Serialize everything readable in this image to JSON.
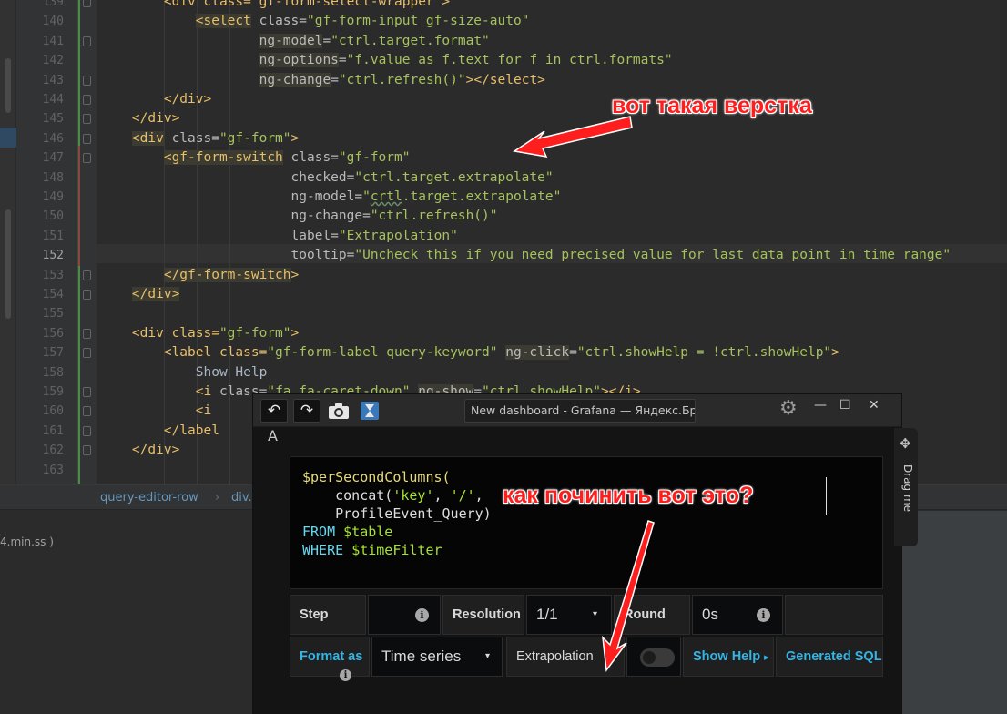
{
  "ide": {
    "line_numbers": [
      "139",
      "140",
      "141",
      "142",
      "143",
      "144",
      "145",
      "146",
      "147",
      "148",
      "149",
      "150",
      "151",
      "152",
      "153",
      "154",
      "155",
      "156",
      "157",
      "158",
      "159",
      "160",
      "161",
      "162",
      "163"
    ],
    "current_line": "152",
    "code_lines": [
      [
        {
          "t": "        <div class=\"gf-form-select-wrapper\">",
          "c": "tg"
        }
      ],
      [
        {
          "t": "            ",
          "c": "tx"
        },
        {
          "t": "<select",
          "c": "hlt"
        },
        {
          "t": " class=",
          "c": "an"
        },
        {
          "t": "\"gf-form-input gf-size-auto\"",
          "c": "av"
        }
      ],
      [
        {
          "t": "                    ",
          "c": "tx"
        },
        {
          "t": "ng-model",
          "c": "an hl"
        },
        {
          "t": "=",
          "c": "an"
        },
        {
          "t": "\"ctrl.target.format\"",
          "c": "av"
        }
      ],
      [
        {
          "t": "                    ",
          "c": "tx"
        },
        {
          "t": "ng-options",
          "c": "an hl"
        },
        {
          "t": "=",
          "c": "an"
        },
        {
          "t": "\"f.value as f.text for f in ctrl.formats\"",
          "c": "av"
        }
      ],
      [
        {
          "t": "                    ",
          "c": "tx"
        },
        {
          "t": "ng-change",
          "c": "an hl"
        },
        {
          "t": "=",
          "c": "an"
        },
        {
          "t": "\"ctrl.refresh()\"",
          "c": "av"
        },
        {
          "t": "></select>",
          "c": "tg"
        }
      ],
      [
        {
          "t": "        </div>",
          "c": "tg"
        }
      ],
      [
        {
          "t": "    </div>",
          "c": "tg"
        }
      ],
      [
        {
          "t": "    ",
          "c": "tx"
        },
        {
          "t": "<div",
          "c": "hlt"
        },
        {
          "t": " class=",
          "c": "an"
        },
        {
          "t": "\"gf-form\"",
          "c": "av"
        },
        {
          "t": ">",
          "c": "tg"
        }
      ],
      [
        {
          "t": "        ",
          "c": "tx"
        },
        {
          "t": "<gf-form-switch",
          "c": "hlt"
        },
        {
          "t": " class=",
          "c": "an"
        },
        {
          "t": "\"gf-form\"",
          "c": "av"
        }
      ],
      [
        {
          "t": "                        checked=",
          "c": "an"
        },
        {
          "t": "\"ctrl.target.extrapolate\"",
          "c": "av"
        }
      ],
      [
        {
          "t": "                        ng-model=",
          "c": "an"
        },
        {
          "t": "\"",
          "c": "av"
        },
        {
          "t": "crtl",
          "c": "av err"
        },
        {
          "t": ".target.extrapolate\"",
          "c": "av"
        }
      ],
      [
        {
          "t": "                        ng-change=",
          "c": "an"
        },
        {
          "t": "\"ctrl.refresh()\"",
          "c": "av"
        }
      ],
      [
        {
          "t": "                        label=",
          "c": "an"
        },
        {
          "t": "\"Extrapolation\"",
          "c": "av"
        }
      ],
      [
        {
          "t": "                        tooltip=",
          "c": "an"
        },
        {
          "t": "\"Uncheck this if you need precised value for last data point in time range\"",
          "c": "av"
        }
      ],
      [
        {
          "t": "        ",
          "c": "tx"
        },
        {
          "t": "</gf-form-switch",
          "c": "hlt"
        },
        {
          "t": ">",
          "c": "tg"
        }
      ],
      [
        {
          "t": "    ",
          "c": "tx"
        },
        {
          "t": "</div>",
          "c": "hlt"
        }
      ],
      [
        {
          "t": "",
          "c": "tx"
        }
      ],
      [
        {
          "t": "    <div class=",
          "c": "tg"
        },
        {
          "t": "\"gf-form\"",
          "c": "av"
        },
        {
          "t": ">",
          "c": "tg"
        }
      ],
      [
        {
          "t": "        <label class=",
          "c": "tg"
        },
        {
          "t": "\"gf-form-label query-keyword\"",
          "c": "av"
        },
        {
          "t": " ",
          "c": "tx"
        },
        {
          "t": "ng-click",
          "c": "an hl"
        },
        {
          "t": "=",
          "c": "an"
        },
        {
          "t": "\"ctrl.showHelp = !ctrl.showHelp\"",
          "c": "av"
        },
        {
          "t": ">",
          "c": "tg"
        }
      ],
      [
        {
          "t": "            Show Help",
          "c": "tx"
        }
      ],
      [
        {
          "t": "            <i ",
          "c": "tg"
        },
        {
          "t": "class=",
          "c": "an"
        },
        {
          "t": "\"fa fa-caret-down\"",
          "c": "av"
        },
        {
          "t": " ",
          "c": "tx"
        },
        {
          "t": "ng-show",
          "c": "an hl"
        },
        {
          "t": "=",
          "c": "an"
        },
        {
          "t": "\"ctrl.showHelp\"",
          "c": "av"
        },
        {
          "t": "></i>",
          "c": "tg"
        }
      ],
      [
        {
          "t": "            <i",
          "c": "tg"
        }
      ],
      [
        {
          "t": "        </label",
          "c": "tg"
        }
      ],
      [
        {
          "t": "    </div>",
          "c": "tg"
        }
      ],
      [
        {
          "t": "",
          "c": "tx"
        }
      ]
    ],
    "breadcrumb": [
      "query-editor-row",
      "div."
    ],
    "breadcrumb_sep": "›",
    "file_tab": "4.min.ss )"
  },
  "window": {
    "title": "New dashboard - Grafana — Яндекс.Брау",
    "undo_icon": "↶",
    "redo_icon": "↷",
    "gear_icon": "⚙",
    "minimize": "—",
    "maximize": "☐",
    "close": "✕"
  },
  "grafana": {
    "letter": "A",
    "query_lines": [
      [
        {
          "t": "$perSecondColumns(",
          "c": "qy"
        }
      ],
      [
        {
          "t": "    concat(",
          "c": "qw"
        },
        {
          "t": "'key'",
          "c": "qs"
        },
        {
          "t": ", ",
          "c": "qw"
        },
        {
          "t": "'/'",
          "c": "qs"
        },
        {
          "t": ", ",
          "c": "qw"
        }
      ],
      [
        {
          "t": "    ProfileEvent_Query)",
          "c": "qw"
        }
      ],
      [
        {
          "t": "FROM ",
          "c": "qb"
        },
        {
          "t": "$table",
          "c": "qs"
        }
      ],
      [
        {
          "t": "WHERE ",
          "c": "qb"
        },
        {
          "t": "$timeFilter",
          "c": "qs"
        }
      ]
    ],
    "step_label": "Step",
    "step_value": "",
    "resolution_label": "Resolution",
    "resolution_value": "1/1",
    "round_label": "Round",
    "round_value": "0s",
    "format_as_label": "Format as",
    "format_as_value": "Time series",
    "extrapolation_label": "Extrapolation",
    "extrapolation_on": false,
    "show_help_label": "Show Help",
    "show_help_caret": "▸",
    "generated_sql_label": "Generated SQL",
    "info_glyph": "i",
    "dropdown_caret": "▾"
  },
  "drag_panel": {
    "label": "Drag me",
    "icon": "✥"
  },
  "annotations": {
    "top": "вот такая верстка",
    "middle": "как починить вот это?",
    "color": "#ff1e1e"
  }
}
